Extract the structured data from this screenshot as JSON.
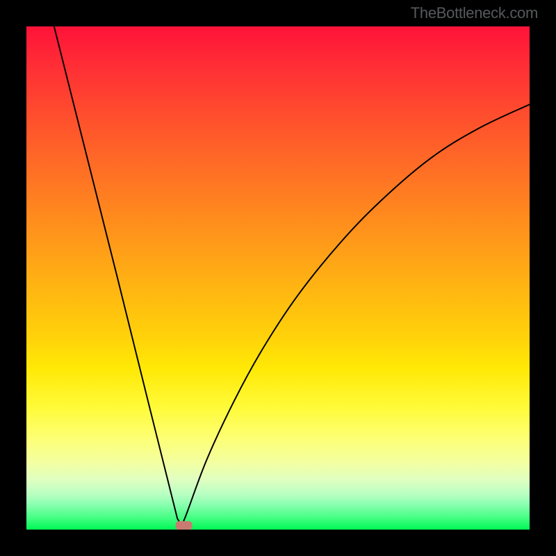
{
  "attribution": "TheBottleneck.com",
  "chart_data": {
    "type": "line",
    "title": "",
    "xlabel": "",
    "ylabel": "",
    "xlim": [
      0,
      1
    ],
    "ylim": [
      0,
      1
    ],
    "curve": {
      "description": "asymmetric V-shaped bottleneck curve; left branch steep/straight, right branch bowed",
      "min_x": 0.305,
      "min_y": 0.99,
      "left_start": {
        "x": 0.055,
        "y": 0.0
      },
      "right_end": {
        "x": 1.0,
        "y": 0.155
      },
      "left_points": [
        {
          "x": 0.055,
          "y": 0.0
        },
        {
          "x": 0.118,
          "y": 0.25
        },
        {
          "x": 0.181,
          "y": 0.5
        },
        {
          "x": 0.243,
          "y": 0.75
        },
        {
          "x": 0.3,
          "y": 0.978
        },
        {
          "x": 0.306,
          "y": 0.988
        }
      ],
      "right_points": [
        {
          "x": 0.306,
          "y": 0.988
        },
        {
          "x": 0.315,
          "y": 0.977
        },
        {
          "x": 0.358,
          "y": 0.862
        },
        {
          "x": 0.414,
          "y": 0.742
        },
        {
          "x": 0.47,
          "y": 0.64
        },
        {
          "x": 0.539,
          "y": 0.535
        },
        {
          "x": 0.622,
          "y": 0.432
        },
        {
          "x": 0.705,
          "y": 0.346
        },
        {
          "x": 0.802,
          "y": 0.263
        },
        {
          "x": 0.898,
          "y": 0.203
        },
        {
          "x": 1.0,
          "y": 0.155
        }
      ]
    },
    "marker": {
      "shape": "rounded-rect",
      "fill": "#c97b72",
      "cx": 0.313,
      "cy": 0.992,
      "w": 0.033,
      "h": 0.018
    },
    "background_gradient": {
      "type": "vertical",
      "stops": [
        {
          "pos": 0.0,
          "color": "#ff1238"
        },
        {
          "pos": 0.5,
          "color": "#ffb012"
        },
        {
          "pos": 0.8,
          "color": "#fdff76"
        },
        {
          "pos": 1.0,
          "color": "#00f855"
        }
      ]
    },
    "frame_color": "#000000"
  }
}
